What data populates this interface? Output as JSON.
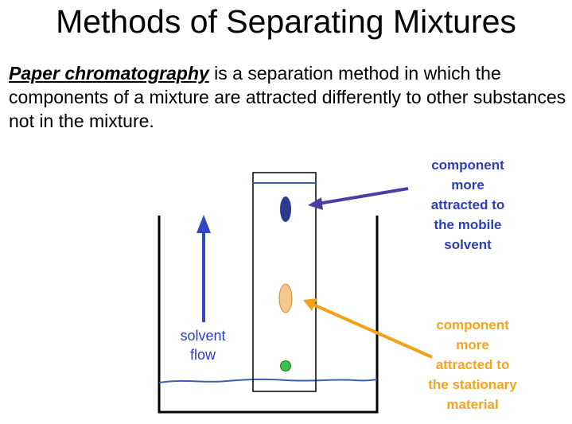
{
  "title": "Methods of Separating Mixtures",
  "intro": {
    "term": "Paper chromatography",
    "text": " is a separation method in which the components of a mixture are attracted differently to other substances not in the mixture."
  },
  "diagram": {
    "solvent_flow_label": "solvent\nflow",
    "mobile_component_label": "component\nmore\nattracted to\nthe mobile\nsolvent",
    "stationary_component_label": "component\nmore\nattracted to\nthe stationary\nmaterial",
    "colors": {
      "mobile_label": "#2c3eb8",
      "stationary_label": "#f5a41e",
      "mobile_spot": "#2e3a8c",
      "stationary_spot": "#f6c98a",
      "starting_spot": "#39c24a",
      "solvent_line": "#3a5fb0",
      "arrow_blue": "#3048c0",
      "arrow_mobile": "#4a3fa0",
      "arrow_stationary": "#f2a11a"
    }
  }
}
